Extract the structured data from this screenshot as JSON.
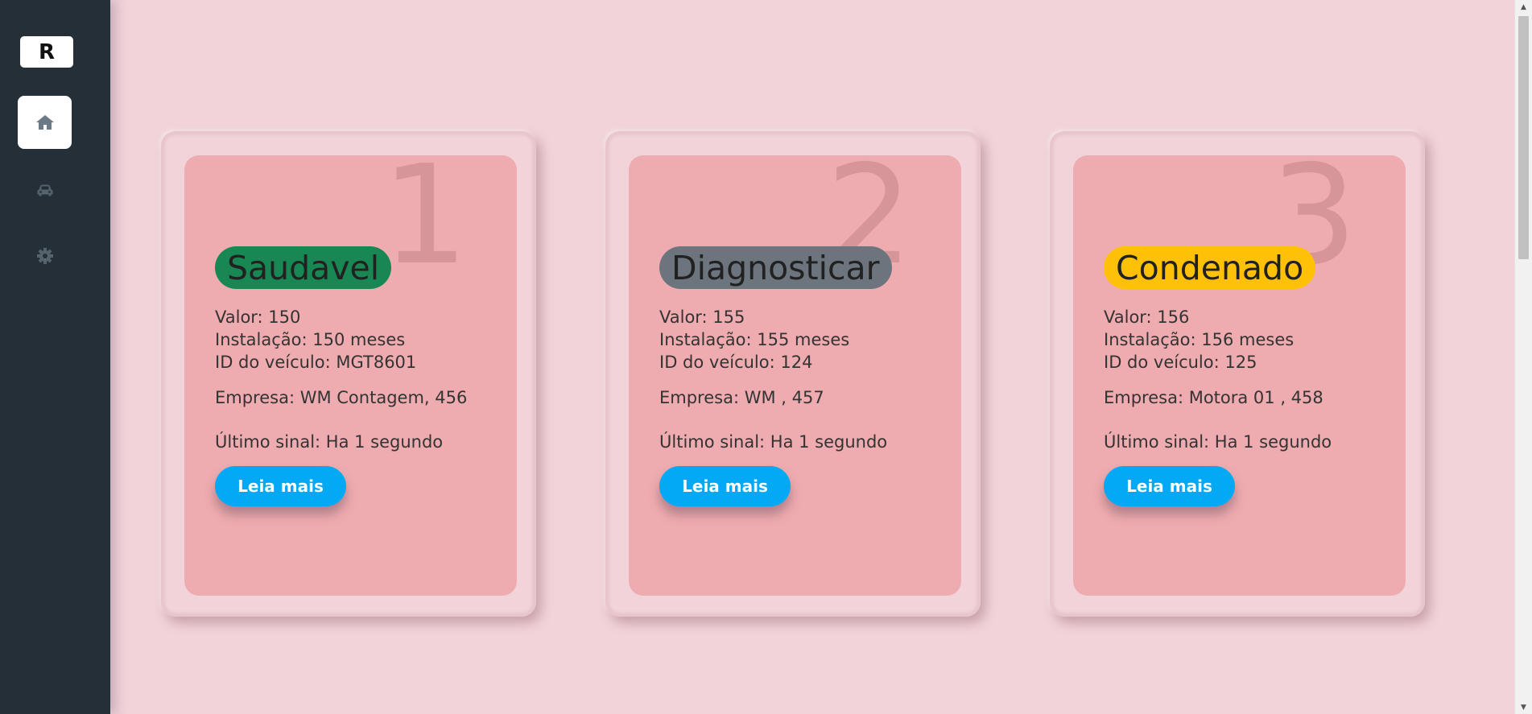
{
  "sidebar": {
    "logo": "R",
    "nav": [
      {
        "icon": "home-icon",
        "active": true
      },
      {
        "icon": "car-icon",
        "active": false
      },
      {
        "icon": "gear-icon",
        "active": false
      }
    ]
  },
  "cards": [
    {
      "number": "1",
      "status": "Saudavel",
      "status_color": "#198754",
      "valor": "Valor: 150",
      "instalacao": "Instalação: 150 meses",
      "veiculo": "ID do veículo: MGT8601",
      "empresa": "Empresa: WM Contagem, 456",
      "sinal": "Último sinal: Ha 1 segundo",
      "button": "Leia mais"
    },
    {
      "number": "2",
      "status": "Diagnosticar",
      "status_color": "#6c757d",
      "valor": "Valor: 155",
      "instalacao": "Instalação: 155 meses",
      "veiculo": "ID do veículo: 124",
      "empresa": "Empresa: WM , 457",
      "sinal": "Último sinal: Ha 1 segundo",
      "button": "Leia mais"
    },
    {
      "number": "3",
      "status": "Condenado",
      "status_color": "#ffc107",
      "valor": "Valor: 156",
      "instalacao": "Instalação: 156 meses",
      "veiculo": "ID do veículo: 125",
      "empresa": "Empresa: Motora 01 , 458",
      "sinal": "Último sinal: Ha 1 segundo",
      "button": "Leia mais"
    }
  ],
  "colors": {
    "background": "#f1d3d9",
    "card": "#efacb0",
    "sidebar": "#242f37",
    "button": "#03a9f4"
  }
}
